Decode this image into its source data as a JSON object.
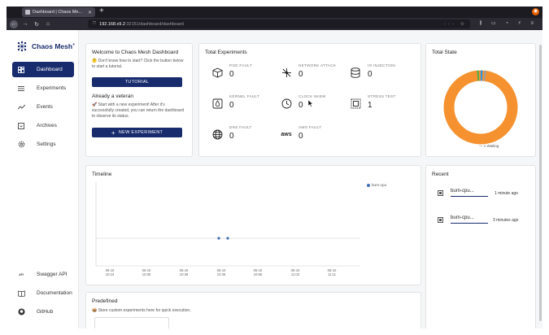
{
  "browser": {
    "tab_title": "Dashboard | Chaos Me...",
    "url_host": "192.168.x9.2",
    "url_path": ":32151/dashboard/dashboard"
  },
  "app": {
    "name": "Chaos Mesh"
  },
  "sidebar": {
    "items": [
      {
        "label": "Dashboard",
        "icon": "dashboard-icon",
        "active": true
      },
      {
        "label": "Experiments",
        "icon": "list-icon"
      },
      {
        "label": "Events",
        "icon": "timeline-icon"
      },
      {
        "label": "Archives",
        "icon": "archive-icon"
      },
      {
        "label": "Settings",
        "icon": "gear-icon"
      }
    ],
    "bottom": [
      {
        "label": "Swagger API",
        "icon": "api-icon"
      },
      {
        "label": "Documentation",
        "icon": "book-icon"
      },
      {
        "label": "GitHub",
        "icon": "github-icon"
      }
    ]
  },
  "welcome": {
    "title": "Welcome to Chaos Mesh Dashboard",
    "intro": "🤔 Don't know how to start? Click the button below to start a tutorial.",
    "tutorial_btn": "TUTORIAL",
    "veteran_title": "Already a veteran",
    "veteran_text": "🚀 Start with a new experiment! After it's successfully created, you can return the dashboard to observe its status.",
    "new_btn": "NEW EXPERIMENT"
  },
  "total_experiments": {
    "title": "Total Experiments",
    "stats": [
      {
        "label": "POD FAULT",
        "value": "0",
        "icon": "cube-icon"
      },
      {
        "label": "NETWORK ATTACK",
        "value": "0",
        "icon": "network-icon"
      },
      {
        "label": "IO INJECTION",
        "value": "0",
        "icon": "database-icon"
      },
      {
        "label": "KERNEL FAULT",
        "value": "0",
        "icon": "linux-icon"
      },
      {
        "label": "CLOCK SKEW",
        "value": "0",
        "icon": "clock-icon"
      },
      {
        "label": "STRESS TEST",
        "value": "1",
        "icon": "stress-icon"
      },
      {
        "label": "DNS FAULT",
        "value": "0",
        "icon": "globe-icon"
      },
      {
        "label": "AWS FAULT",
        "value": "0",
        "icon": "aws-icon"
      }
    ]
  },
  "total_state": {
    "title": "Total State",
    "legend": "1 Waiting",
    "colors": {
      "main": "#f5922f",
      "accent1": "#4caf50",
      "accent2": "#2196f3",
      "accent3": "#9e9e9e"
    }
  },
  "timeline": {
    "title": "Timeline",
    "series_name": "burn-cpu",
    "x_labels": [
      [
        "05-10",
        "10:23"
      ],
      [
        "05-10",
        "10:30"
      ],
      [
        "05-10",
        "10:38"
      ],
      [
        "05-10",
        "10:46"
      ],
      [
        "05-10",
        "10:55"
      ],
      [
        "05-10",
        "11:03"
      ],
      [
        "05-10",
        "11:11"
      ]
    ]
  },
  "recent": {
    "title": "Recent",
    "items": [
      {
        "name": "burn-cpu...",
        "time": "1 minute ago"
      },
      {
        "name": "burn-cpu...",
        "time": "3 minutes ago"
      }
    ]
  },
  "predefined": {
    "title": "Predefined",
    "text": "📦 Store custom experiments here for quick execution."
  }
}
